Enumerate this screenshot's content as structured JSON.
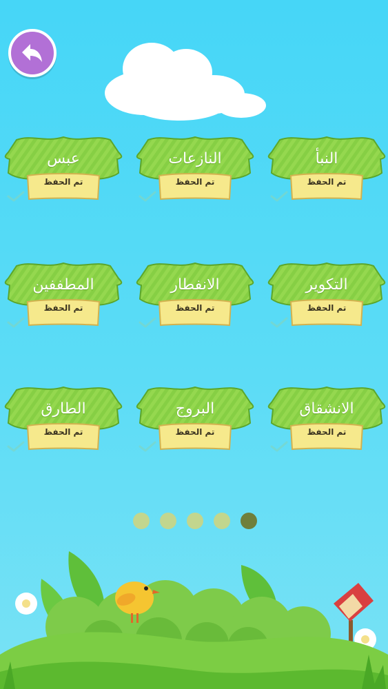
{
  "back_button": {
    "icon": "back-arrow-icon"
  },
  "surahs": [
    {
      "name": "النبأ",
      "status": "تم الحفظ"
    },
    {
      "name": "النازعات",
      "status": "تم الحفظ"
    },
    {
      "name": "عبس",
      "status": "تم الحفظ"
    },
    {
      "name": "التكوير",
      "status": "تم الحفظ"
    },
    {
      "name": "الانفطار",
      "status": "تم الحفظ"
    },
    {
      "name": "المطففين",
      "status": "تم الحفظ"
    },
    {
      "name": "الانشقاق",
      "status": "تم الحفظ"
    },
    {
      "name": "البروج",
      "status": "تم الحفظ"
    },
    {
      "name": "الطارق",
      "status": "تم الحفظ"
    }
  ],
  "pagination": {
    "pages": 5,
    "current": 5
  },
  "colors": {
    "sky": "#46d6f7",
    "banner_green": "#8fd64c",
    "ribbon_yellow": "#f6e98c",
    "back_button": "#b270d6",
    "dot_inactive": "#c2d68e",
    "dot_active": "#6f7f3c"
  }
}
